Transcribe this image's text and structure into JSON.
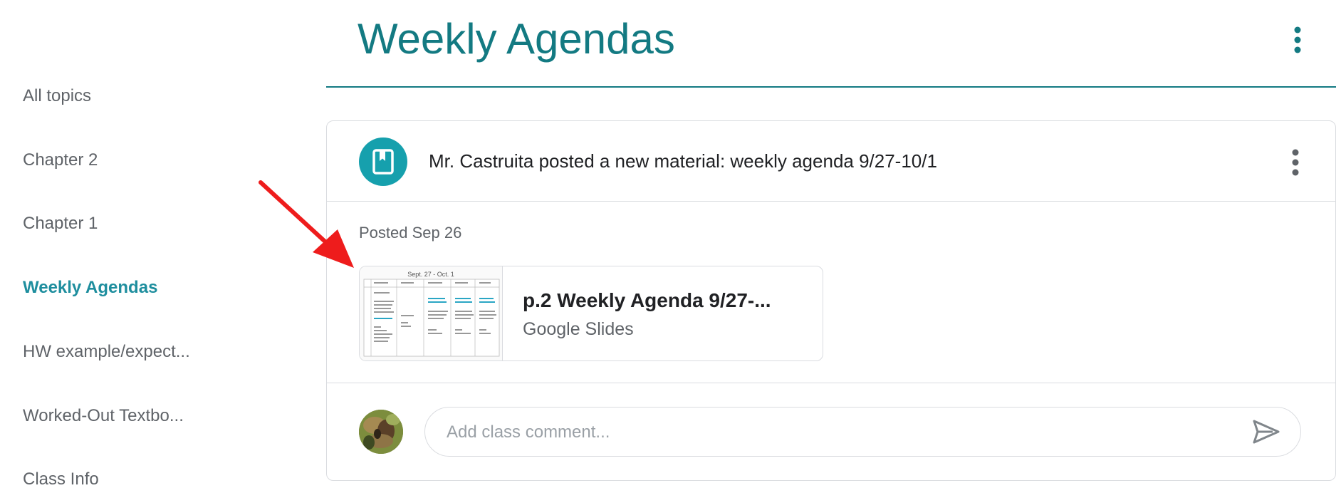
{
  "sidebar": {
    "items": [
      {
        "label": "All topics",
        "active": false
      },
      {
        "label": "Chapter 2",
        "active": false
      },
      {
        "label": "Chapter 1",
        "active": false
      },
      {
        "label": "Weekly Agendas",
        "active": true
      },
      {
        "label": "HW example/expect...",
        "active": false
      },
      {
        "label": "Worked-Out Textbo...",
        "active": false
      },
      {
        "label": "Class Info",
        "active": false
      }
    ]
  },
  "header": {
    "title": "Weekly Agendas",
    "more_icon": "more-vert-icon"
  },
  "post": {
    "icon": "bookmark-icon",
    "title": "Mr. Castruita posted a new material: weekly agenda 9/27-10/1",
    "posted": "Posted Sep 26",
    "attachment": {
      "title": "p.2 Weekly Agenda 9/27-...",
      "type": "Google Slides",
      "thumbnail_heading": "Sept. 27 - Oct. 1"
    }
  },
  "comment": {
    "placeholder": "Add class comment...",
    "send_icon": "send-icon"
  },
  "colors": {
    "accent": "#137a82",
    "active_nav": "#1e8e9e",
    "material_icon_bg": "#16a0ad",
    "annotation_arrow": "#ee1c1c"
  }
}
